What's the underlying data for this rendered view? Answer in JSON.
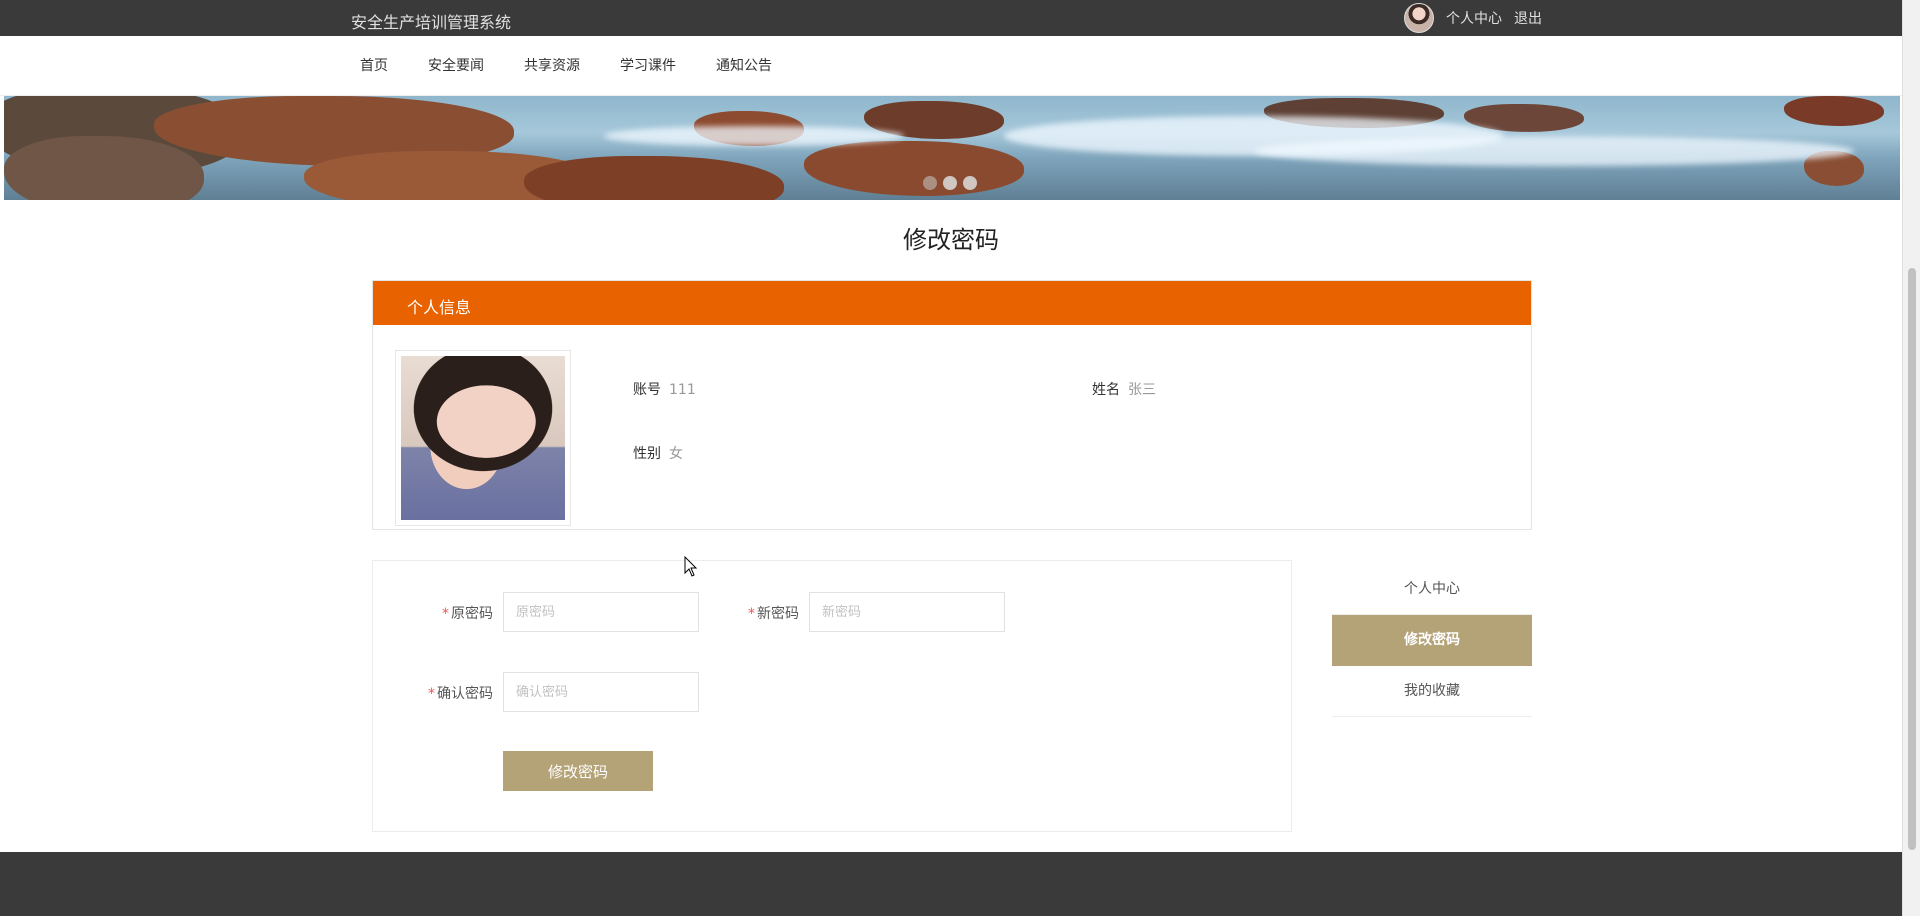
{
  "header": {
    "site_title": "安全生产培训管理系统",
    "user_center": "个人中心",
    "logout": "退出"
  },
  "nav": {
    "items": [
      {
        "label": "首页"
      },
      {
        "label": "安全要闻"
      },
      {
        "label": "共享资源"
      },
      {
        "label": "学习课件"
      },
      {
        "label": "通知公告"
      }
    ]
  },
  "banner": {
    "slide_count": 3,
    "active_slide": 1
  },
  "page_title": "修改密码",
  "info_panel": {
    "heading": "个人信息",
    "account_label": "账号",
    "account_value": "111",
    "name_label": "姓名",
    "name_value": "张三",
    "gender_label": "性别",
    "gender_value": "女"
  },
  "form": {
    "required_mark": "*",
    "old_password_label": "原密码",
    "old_password_placeholder": "原密码",
    "new_password_label": "新密码",
    "new_password_placeholder": "新密码",
    "confirm_password_label": "确认密码",
    "confirm_password_placeholder": "确认密码",
    "submit_label": "修改密码"
  },
  "side_menu": {
    "items": [
      {
        "label": "个人中心"
      },
      {
        "label": "修改密码"
      },
      {
        "label": "我的收藏"
      }
    ],
    "active_index": 1
  },
  "colors": {
    "topbar": "#3a3a3a",
    "accent_orange": "#e86200",
    "accent_tan": "#b5a378",
    "footer": "#3a3a3a"
  }
}
